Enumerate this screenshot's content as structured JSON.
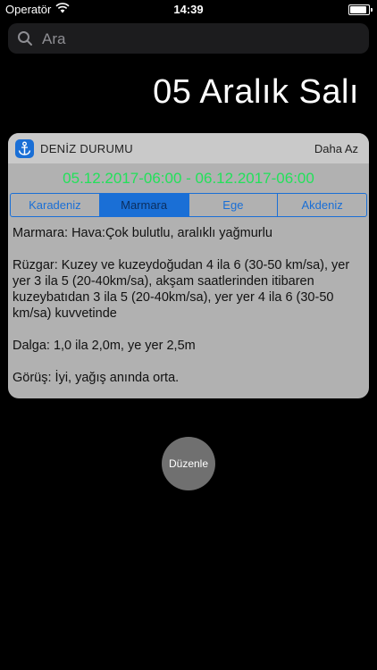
{
  "status_bar": {
    "carrier": "Operatör",
    "time": "14:39",
    "battery_level": 1.0
  },
  "search": {
    "placeholder": "Ara",
    "value": ""
  },
  "date_header": "05 Aralık Salı",
  "widget": {
    "title": "DENİZ DURUMU",
    "toggle_label": "Daha Az",
    "date_range": "05.12.2017-06:00 - 06.12.2017-06:00",
    "tabs": [
      {
        "label": "Karadeniz",
        "active": false
      },
      {
        "label": "Marmara",
        "active": true
      },
      {
        "label": "Ege",
        "active": false
      },
      {
        "label": "Akdeniz",
        "active": false
      }
    ],
    "report": {
      "weather": "Marmara: Hava:Çok bulutlu, aralıklı yağmurlu",
      "wind": "Rüzgar: Kuzey ve kuzeydoğudan 4 ila 6 (30-50 km/sa), yer yer 3 ila 5 (20-40km/sa), akşam saatlerinden itibaren kuzeybatıdan 3 ila 5 (20-40km/sa), yer yer 4 ila 6 (30-50 km/sa) kuvvetinde",
      "wave": "Dalga: 1,0 ila 2,0m, ye yer 2,5m",
      "visibility": "Görüş: İyi, yağış anında orta."
    }
  },
  "edit_button_label": "Düzenle",
  "colors": {
    "accent": "#1a6fd6",
    "date_range_green": "#22e15a",
    "widget_bg": "#b1b1b1"
  },
  "icons": {
    "wifi": "wifi-icon",
    "search": "search-icon",
    "app": "anchor-icon"
  }
}
